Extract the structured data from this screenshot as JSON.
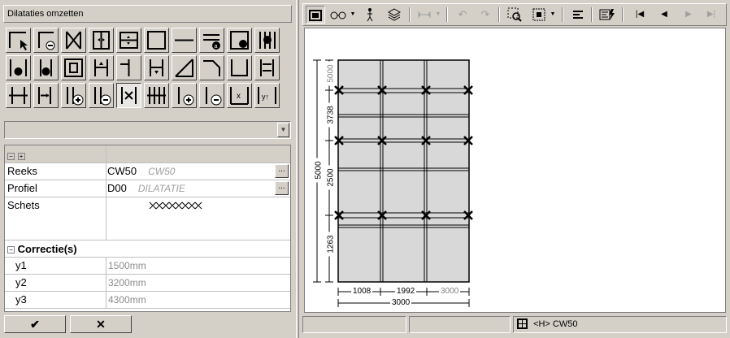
{
  "panel": {
    "title": "Dilataties omzetten"
  },
  "palette": {
    "rows": [
      [
        "corner-select-icon",
        "corner-minus-icon",
        "cross-frame-icon",
        "split-vertical-icon",
        "split-horizontal-icon",
        "frame-outline-icon",
        "bar-horizontal-icon",
        "arrow-a-icon",
        "frame-e-icon",
        "bars-d-icon"
      ],
      [
        "bars-i-icon",
        "bars-m-icon",
        "frame-inner-icon",
        "bars-up-icon",
        "bar-t-icon",
        "bars-down-icon",
        "diagonal-icon",
        "corner-bevel-icon",
        "u-frame-icon",
        "bars-arrow-icon"
      ],
      [
        "split-bars-icon",
        "arrow-bars-icon",
        "bars-plus-icon",
        "bars-minus-icon",
        "dilatation-cross-icon",
        "bars-cross-icon",
        "bar-plus-icon",
        "bar-minus-icon",
        "dimension-x-icon",
        "dimension-y-icon"
      ]
    ],
    "pressed_index": [
      2,
      4
    ]
  },
  "combo": {
    "value": ""
  },
  "grid": {
    "rows": [
      {
        "label": "Reeks",
        "value": "CW50",
        "ghost": "CW50",
        "ellipsis": "..."
      },
      {
        "label": "Profiel",
        "value": "D00",
        "ghost": "DILATATIE",
        "ellipsis": "..."
      },
      {
        "label": "Schets",
        "value": "",
        "ghost": ""
      }
    ],
    "section": "Correctie(s)",
    "corrections": [
      {
        "label": "y1",
        "value": "1500mm"
      },
      {
        "label": "y2",
        "value": "3200mm"
      },
      {
        "label": "y3",
        "value": "4300mm"
      }
    ]
  },
  "buttons": {
    "ok": "✔",
    "cancel": "✕"
  },
  "toolbar": {
    "items": [
      "window-icon",
      "glasses-icon",
      "dropdown-icon",
      "person-icon",
      "layers-icon",
      "dimension-icon",
      "dropdown-icon",
      "undo-icon",
      "redo-icon",
      "zoom-select-icon",
      "frame-select-icon",
      "dropdown-icon",
      "align-left-icon",
      "lightning-icon",
      "first-icon",
      "prev-icon",
      "next-icon",
      "last-icon"
    ]
  },
  "drawing": {
    "left_dims": [
      "5000",
      "3738",
      "2500",
      "1263"
    ],
    "total_height": "5000",
    "bottom_dims": [
      "1008",
      "1992",
      "3000"
    ],
    "total_width": "3000"
  },
  "status": {
    "panel1": "",
    "panel2": "",
    "panel3": "<H> CW50"
  }
}
